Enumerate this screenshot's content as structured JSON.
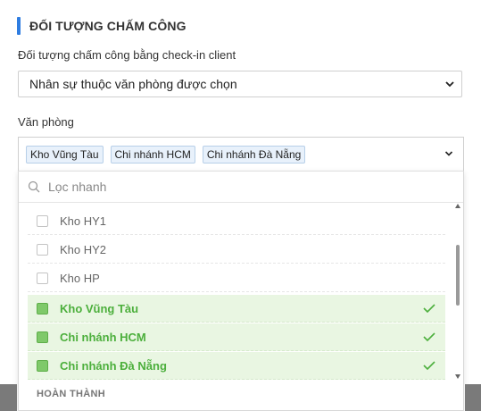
{
  "section": {
    "title": "ĐỐI TƯỢNG CHẤM CÔNG",
    "accent_color": "#2f7de1"
  },
  "checkin_field": {
    "label": "Đối tượng chấm công bằng check-in client",
    "selected_value": "Nhân sự thuộc văn phòng được chọn"
  },
  "office_field": {
    "label": "Văn phòng",
    "tags": [
      "Kho Vũng Tàu",
      "Chi nhánh HCM",
      "Chi nhánh Đà Nẵng"
    ]
  },
  "dropdown": {
    "search_placeholder": "Lọc nhanh",
    "items": [
      {
        "label": "Kho HY1",
        "selected": false
      },
      {
        "label": "Kho HY2",
        "selected": false
      },
      {
        "label": "Kho HP",
        "selected": false
      },
      {
        "label": "Kho Vũng Tàu",
        "selected": true
      },
      {
        "label": "Chi nhánh HCM",
        "selected": true
      },
      {
        "label": "Chi nhánh Đà Nẵng",
        "selected": true
      }
    ],
    "done_label": "HOÀN THÀNH",
    "selected_color": "#4caf3c"
  }
}
